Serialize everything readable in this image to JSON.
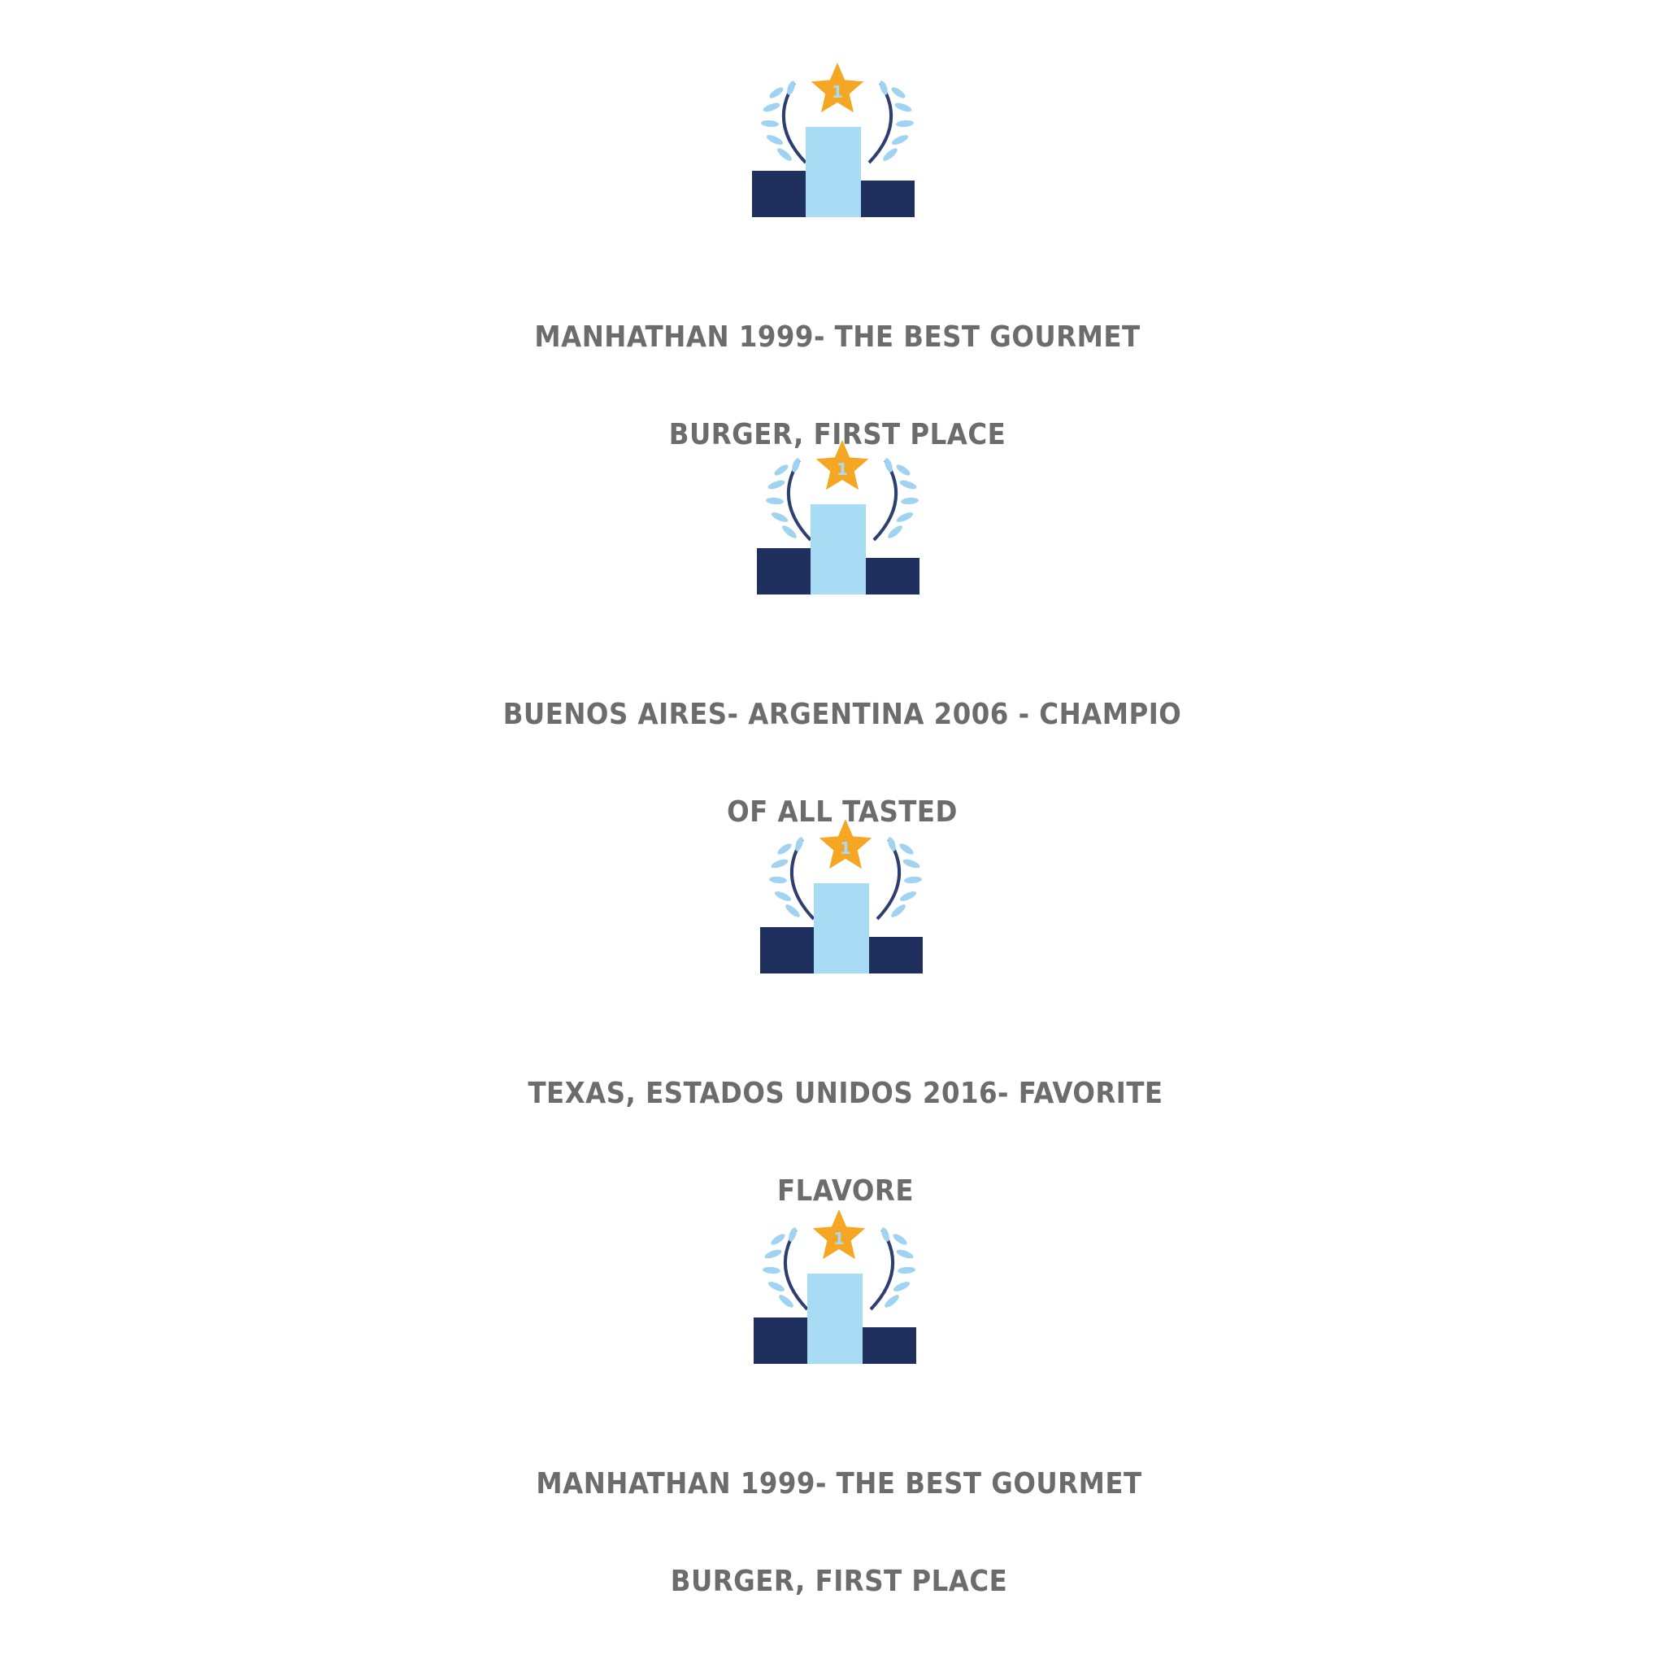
{
  "colors": {
    "text": "#6c6c6c",
    "podium_side": "#1f2f5e",
    "podium_center": "#a8dcf5",
    "star": "#f5a623",
    "laurel_stem": "#2d3f6e",
    "laurel_leaf": "#9fd3f1",
    "background": "#ffffff"
  },
  "icon_semantic": "podium-trophy-icon",
  "awards": [
    {
      "star_number": "1",
      "line1": "MANHATHAN 1999- THE BEST GOURMET",
      "line2": "BURGER, FIRST PLACE"
    },
    {
      "star_number": "1",
      "line1": "BUENOS AIRES- ARGENTINA 2006 - CHAMPIO",
      "line2": "OF ALL TASTED"
    },
    {
      "star_number": "1",
      "line1": "TEXAS, ESTADOS UNIDOS 2016- FAVORITE",
      "line2": "FLAVORE"
    },
    {
      "star_number": "1",
      "line1": "MANHATHAN 1999- THE BEST GOURMET",
      "line2": "BURGER, FIRST PLACE"
    }
  ]
}
